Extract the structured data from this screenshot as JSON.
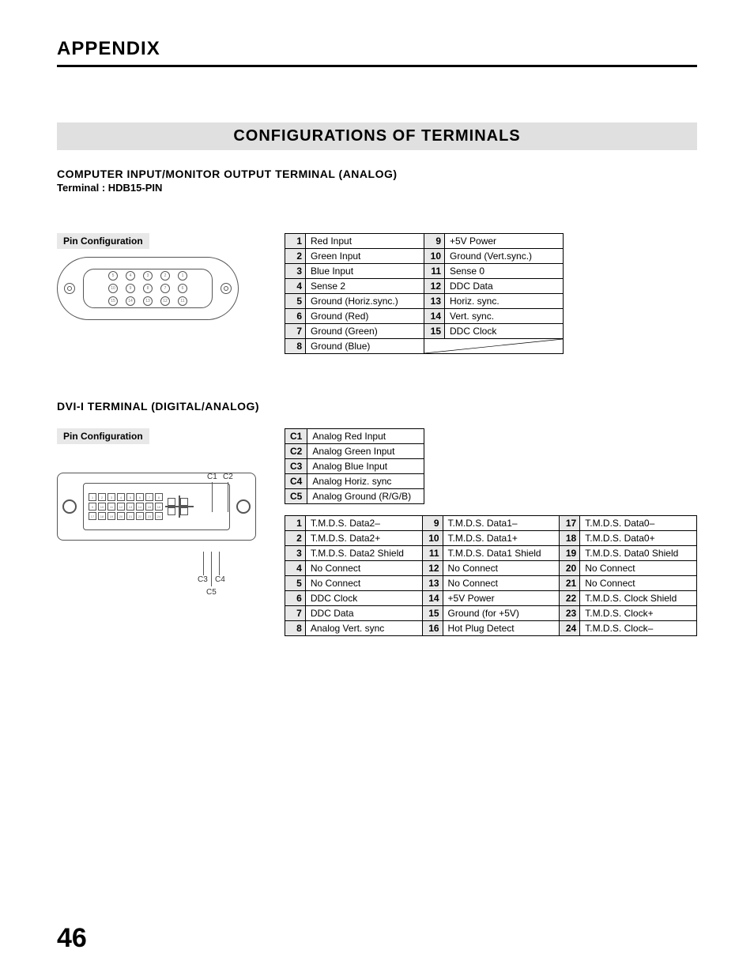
{
  "header": "APPENDIX",
  "section_banner": "CONFIGURATIONS OF TERMINALS",
  "analog": {
    "heading": "COMPUTER INPUT/MONITOR OUTPUT TERMINAL (ANALOG)",
    "terminal": "Terminal : HDB15-PIN",
    "pin_config_label": "Pin Configuration",
    "pins": [
      {
        "n": "1",
        "v": "Red Input"
      },
      {
        "n": "2",
        "v": "Green Input"
      },
      {
        "n": "3",
        "v": "Blue Input"
      },
      {
        "n": "4",
        "v": "Sense 2"
      },
      {
        "n": "5",
        "v": "Ground (Horiz.sync.)"
      },
      {
        "n": "6",
        "v": "Ground (Red)"
      },
      {
        "n": "7",
        "v": "Ground (Green)"
      },
      {
        "n": "8",
        "v": "Ground (Blue)"
      },
      {
        "n": "9",
        "v": "+5V Power"
      },
      {
        "n": "10",
        "v": "Ground (Vert.sync.)"
      },
      {
        "n": "11",
        "v": "Sense 0"
      },
      {
        "n": "12",
        "v": "DDC Data"
      },
      {
        "n": "13",
        "v": "Horiz. sync."
      },
      {
        "n": "14",
        "v": "Vert. sync."
      },
      {
        "n": "15",
        "v": "DDC Clock"
      }
    ]
  },
  "dvi": {
    "heading": "DVI-I TERMINAL (DIGITAL/ANALOG)",
    "pin_config_label": "Pin Configuration",
    "callouts": {
      "c1": "C1",
      "c2": "C2",
      "c3": "C3",
      "c4": "C4",
      "c5": "C5"
    },
    "cpins": [
      {
        "n": "C1",
        "v": "Analog Red Input"
      },
      {
        "n": "C2",
        "v": "Analog Green Input"
      },
      {
        "n": "C3",
        "v": "Analog Blue Input"
      },
      {
        "n": "C4",
        "v": "Analog Horiz. sync"
      },
      {
        "n": "C5",
        "v": "Analog Ground (R/G/B)"
      }
    ],
    "pins": [
      {
        "n": "1",
        "v": "T.M.D.S. Data2–"
      },
      {
        "n": "2",
        "v": "T.M.D.S. Data2+"
      },
      {
        "n": "3",
        "v": "T.M.D.S. Data2 Shield"
      },
      {
        "n": "4",
        "v": "No Connect"
      },
      {
        "n": "5",
        "v": "No Connect"
      },
      {
        "n": "6",
        "v": "DDC Clock"
      },
      {
        "n": "7",
        "v": "DDC Data"
      },
      {
        "n": "8",
        "v": "Analog Vert. sync"
      },
      {
        "n": "9",
        "v": "T.M.D.S. Data1–"
      },
      {
        "n": "10",
        "v": "T.M.D.S. Data1+"
      },
      {
        "n": "11",
        "v": "T.M.D.S. Data1 Shield"
      },
      {
        "n": "12",
        "v": "No Connect"
      },
      {
        "n": "13",
        "v": "No Connect"
      },
      {
        "n": "14",
        "v": "+5V Power"
      },
      {
        "n": "15",
        "v": "Ground (for +5V)"
      },
      {
        "n": "16",
        "v": "Hot Plug Detect"
      },
      {
        "n": "17",
        "v": "T.M.D.S. Data0–"
      },
      {
        "n": "18",
        "v": "T.M.D.S. Data0+"
      },
      {
        "n": "19",
        "v": "T.M.D.S. Data0 Shield"
      },
      {
        "n": "20",
        "v": "No Connect"
      },
      {
        "n": "21",
        "v": "No Connect"
      },
      {
        "n": "22",
        "v": "T.M.D.S. Clock Shield"
      },
      {
        "n": "23",
        "v": "T.M.D.S. Clock+"
      },
      {
        "n": "24",
        "v": "T.M.D.S. Clock–"
      }
    ]
  },
  "page_number": "46"
}
